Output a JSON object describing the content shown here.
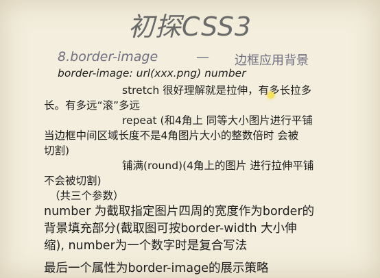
{
  "slide": {
    "title": "初探CSS3",
    "subtitle_prefix": "8.border-image",
    "subtitle_dash": "—",
    "subtitle_zh": "边框应用背景",
    "lines": [
      "border-image: url(xxx.png)   number",
      "stretch 很好理解就是拉伸，有多长拉多",
      "长。有多远“滚”多远",
      "repeat (和4角上 同等大小图片进行平铺",
      "当边框中间区域长度不是4角图片大小的整数倍时 会被",
      "切割)",
      "铺满(round)(4角上的图片 进行拉伸平铺",
      "不会被切割)",
      "（共三个参数）",
      "number 为截取指定图片四周的宽度作为border的",
      "背景填充部分(截取图可按border-width 大小伸",
      "缩), number为一个数字时是复合写法",
      "最后一个属性为border-image的展示策略"
    ]
  }
}
